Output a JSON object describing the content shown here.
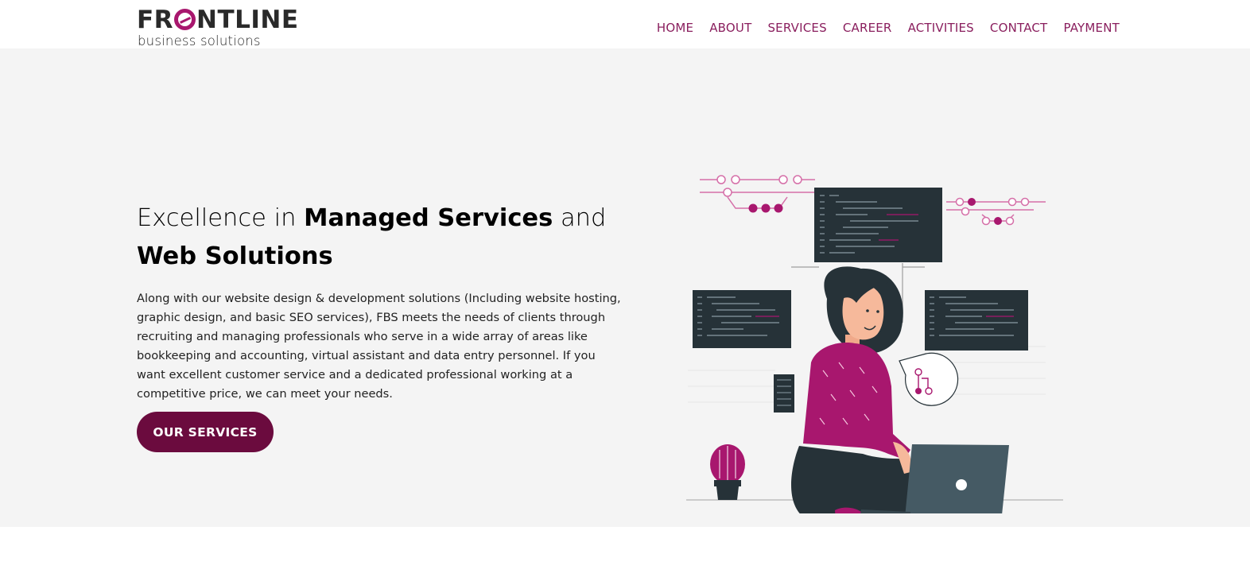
{
  "header": {
    "logo": {
      "main_pre": "FR",
      "main_post": "NTLINE",
      "sub": "business solutions"
    },
    "nav": [
      "HOME",
      "ABOUT",
      "SERVICES",
      "CAREER",
      "ACTIVITIES",
      "CONTACT",
      "PAYMENT"
    ]
  },
  "hero": {
    "headline": {
      "part1": "Excellence in ",
      "bold1": "Managed Services",
      "part2": " and",
      "bold2": "Web Solutions"
    },
    "description": "Along with our website design & development solutions (Including website hosting, graphic design, and basic SEO services), FBS meets the needs of clients through recruiting and managing professionals who serve in a wide array of areas like bookkeeping and accounting, virtual assistant and data entry personnel. If you want excellent customer service and a dedicated professional working at a competitive price, we can meet your needs.",
    "cta_label": "OUR SERVICES"
  },
  "colors": {
    "brand": "#a8176e",
    "nav_text": "#8a1f5e",
    "button_bg": "#6b0b3e",
    "hero_bg": "#f4f4f4",
    "dark_panel": "#263238"
  }
}
